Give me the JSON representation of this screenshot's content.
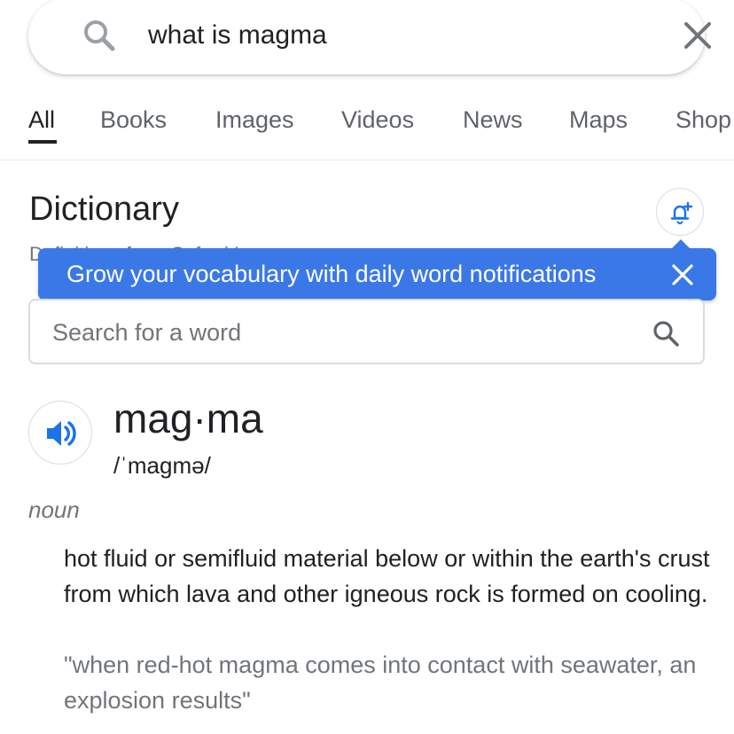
{
  "search": {
    "query": "what is magma",
    "icon": "search-icon",
    "clear_icon": "close-icon"
  },
  "tabs": [
    {
      "label": "All",
      "active": true
    },
    {
      "label": "Books"
    },
    {
      "label": "Images"
    },
    {
      "label": "Videos"
    },
    {
      "label": "News"
    },
    {
      "label": "Maps"
    },
    {
      "label": "Shop"
    }
  ],
  "dictionary": {
    "title": "Dictionary",
    "subtitle": "Definitions from Oxford Languages",
    "bell_icon": "bell-plus-icon",
    "tooltip": {
      "text": "Grow your vocabulary with daily word notifications",
      "close_icon": "close-icon"
    },
    "word_search": {
      "placeholder": "Search for a word",
      "icon": "search-icon"
    },
    "entry": {
      "headword": "mag·ma",
      "pronunciation": "/ˈmaɡmə/",
      "speaker_icon": "speaker-icon",
      "part_of_speech": "noun",
      "definition": "hot fluid or semifluid material below or within the earth's crust from which lava and other igneous rock is formed on cooling.",
      "example": "\"when red-hot magma comes into contact with seawater, an explosion results\""
    }
  },
  "colors": {
    "accent": "#3b78e7",
    "text": "#202124",
    "secondary_text": "#70757a",
    "border": "#dadce0"
  }
}
